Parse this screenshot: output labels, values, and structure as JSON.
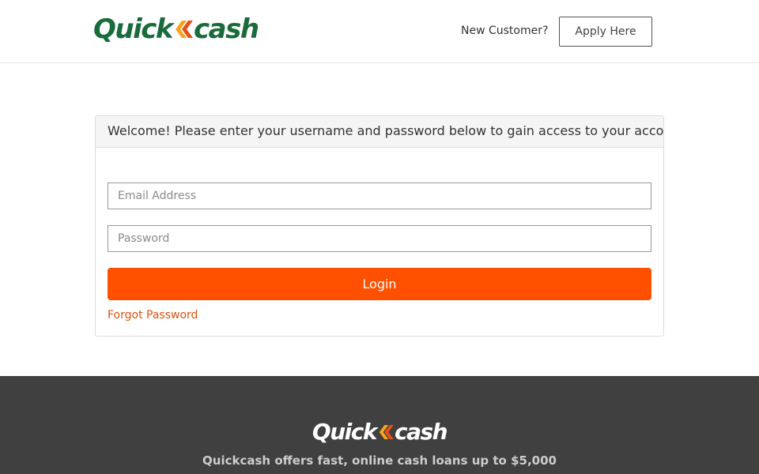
{
  "header": {
    "logo": {
      "part1": "Quick",
      "part2": "cash"
    },
    "new_customer_text": "New Customer?",
    "apply_label": "Apply Here"
  },
  "login": {
    "heading": "Welcome! Please enter your username and password below to gain access to your account",
    "email": {
      "placeholder": "Email Address",
      "value": ""
    },
    "password": {
      "placeholder": "Password",
      "value": ""
    },
    "login_label": "Login",
    "forgot_label": "Forgot Password"
  },
  "footer": {
    "logo": {
      "part1": "Quick",
      "part2": "cash"
    },
    "tagline": "Quickcash offers fast, online cash loans up to $5,000"
  },
  "colors": {
    "brand_green": "#1a6b3c",
    "accent_orange": "#ff5000",
    "link_orange": "#e0520f",
    "footer_bg": "#404040"
  },
  "icons": {
    "logo_chevrons": "double-chevron-left-icon"
  }
}
